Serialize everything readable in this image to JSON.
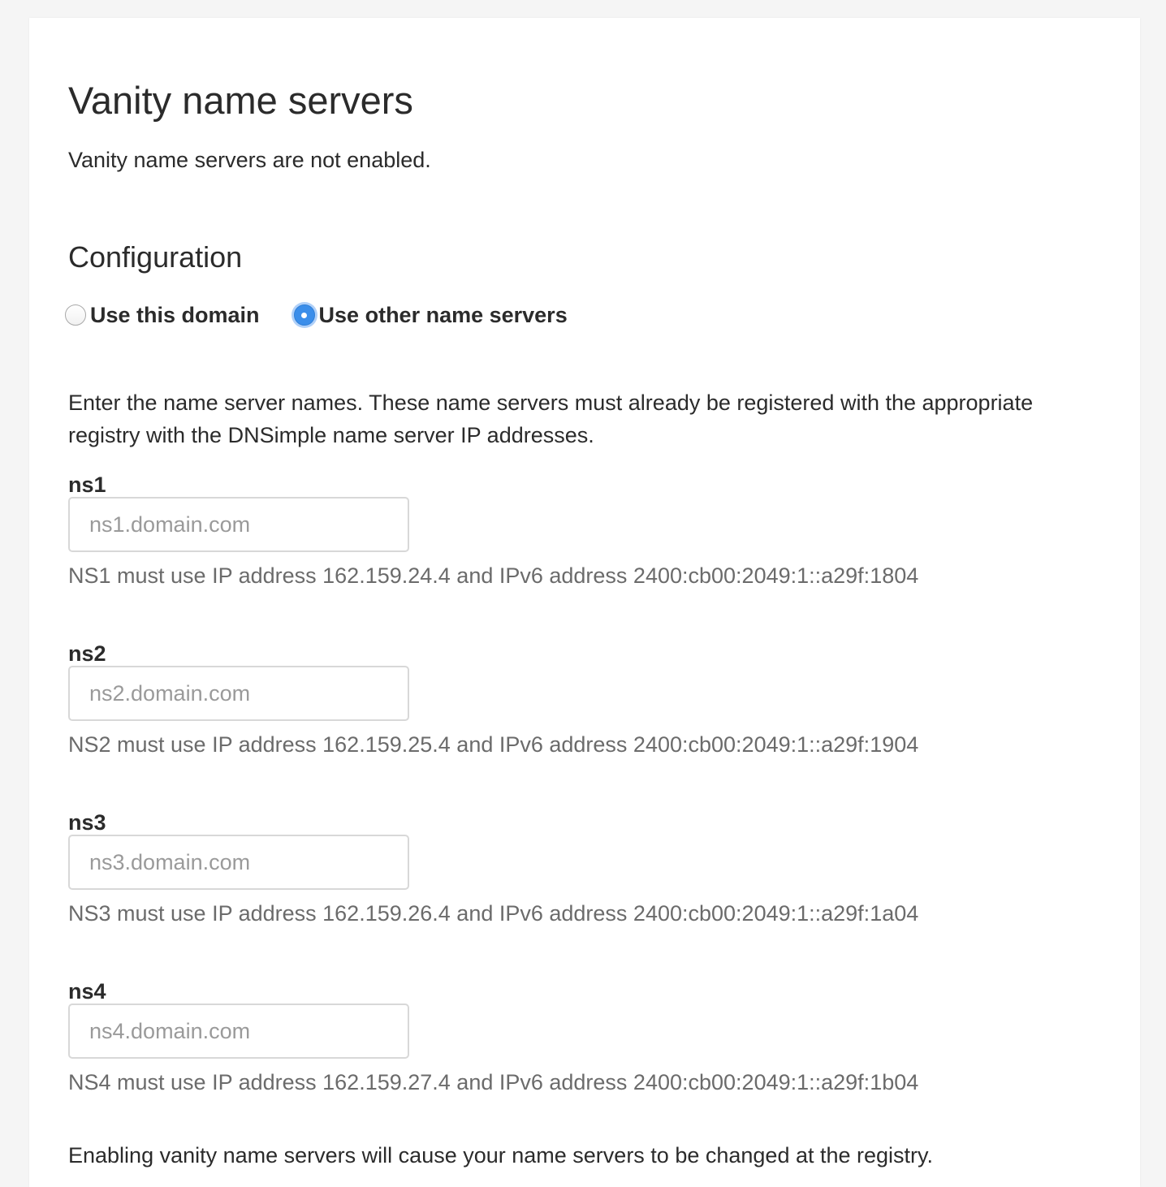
{
  "page": {
    "title": "Vanity name servers",
    "status": "Vanity name servers are not enabled."
  },
  "configuration": {
    "heading": "Configuration",
    "options": [
      {
        "label": "Use this domain",
        "checked": false
      },
      {
        "label": "Use other name servers",
        "checked": true
      }
    ],
    "intro": "Enter the name server names. These name servers must already be registered with the appropriate registry with the DNSimple name server IP addresses."
  },
  "name_servers": [
    {
      "label": "ns1",
      "value": "",
      "placeholder": "ns1.domain.com",
      "hint": "NS1 must use IP address 162.159.24.4 and IPv6 address 2400:cb00:2049:1::a29f:1804"
    },
    {
      "label": "ns2",
      "value": "",
      "placeholder": "ns2.domain.com",
      "hint": "NS2 must use IP address 162.159.25.4 and IPv6 address 2400:cb00:2049:1::a29f:1904"
    },
    {
      "label": "ns3",
      "value": "",
      "placeholder": "ns3.domain.com",
      "hint": "NS3 must use IP address 162.159.26.4 and IPv6 address 2400:cb00:2049:1::a29f:1a04"
    },
    {
      "label": "ns4",
      "value": "",
      "placeholder": "ns4.domain.com",
      "hint": "NS4 must use IP address 162.159.27.4 and IPv6 address 2400:cb00:2049:1::a29f:1b04"
    }
  ],
  "footer": {
    "note": "Enabling vanity name servers will cause your name servers to be changed at the registry."
  },
  "colors": {
    "radio_checked": "#3b8eea",
    "hint_text": "#6b6b6b",
    "input_border": "#d8d8d8"
  }
}
